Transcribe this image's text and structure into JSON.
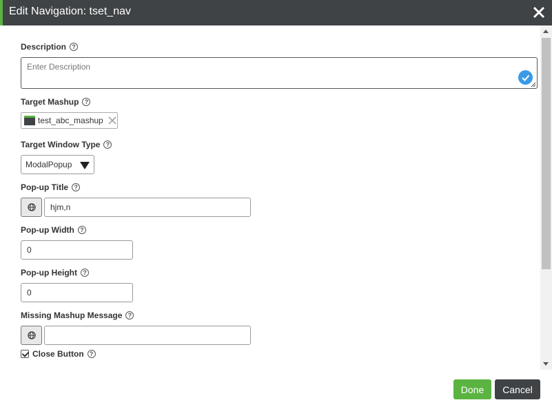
{
  "dialog": {
    "title": "Edit Navigation: tset_nav"
  },
  "fields": {
    "description": {
      "label": "Description",
      "placeholder": "Enter Description",
      "value": ""
    },
    "target_mashup": {
      "label": "Target Mashup",
      "value": "test_abc_mashup"
    },
    "target_window_type": {
      "label": "Target Window Type",
      "value": "ModalPopup"
    },
    "popup_title": {
      "label": "Pop-up Title",
      "value": "hjm,n"
    },
    "popup_width": {
      "label": "Pop-up Width",
      "value": "0"
    },
    "popup_height": {
      "label": "Pop-up Height",
      "value": "0"
    },
    "missing_mashup_message": {
      "label": "Missing Mashup Message",
      "value": ""
    },
    "close_button": {
      "label": "Close Button",
      "checked": true
    }
  },
  "buttons": {
    "done": "Done",
    "cancel": "Cancel"
  },
  "help_glyph": "?",
  "icons": {
    "close": "close-icon",
    "help": "help-icon",
    "check": "check-icon",
    "mashup": "mashup-icon",
    "globe": "globe-icon",
    "dropdown": "triangle-down-icon"
  },
  "colors": {
    "titlebar": "#3f4346",
    "accent_green": "#5bb441",
    "check_blue": "#3a9ae8"
  }
}
